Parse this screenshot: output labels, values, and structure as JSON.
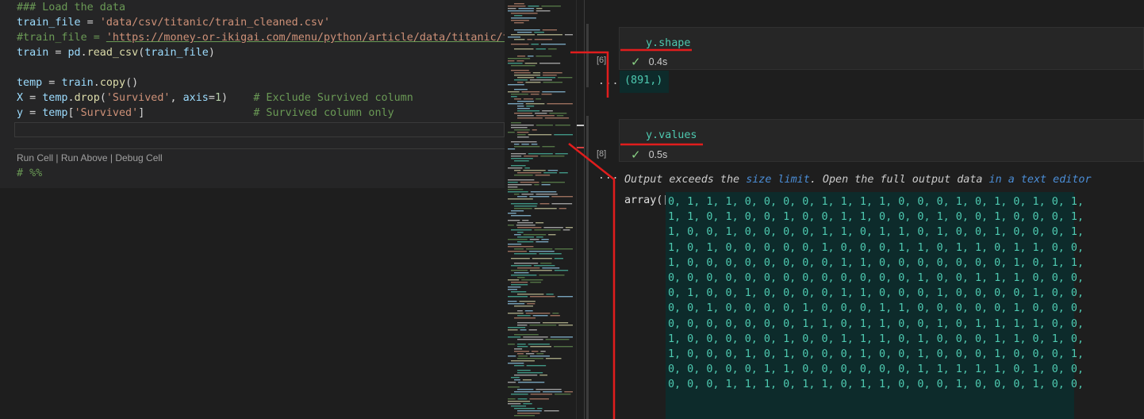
{
  "editor": {
    "lines": [
      {
        "parts": [
          {
            "t": "### Load the data",
            "c": "c-comment"
          }
        ]
      },
      {
        "parts": [
          {
            "t": "train_file",
            "c": "c-var"
          },
          {
            "t": " = ",
            "c": "c-op"
          },
          {
            "t": "'data/csv/titanic/train_cleaned.csv'",
            "c": "c-str"
          }
        ]
      },
      {
        "parts": [
          {
            "t": "#train_file = ",
            "c": "c-comment"
          },
          {
            "t": "'https://money-or-ikigai.com/menu/python/article/data/titanic/trai",
            "c": "c-link"
          }
        ]
      },
      {
        "parts": [
          {
            "t": "train",
            "c": "c-var"
          },
          {
            "t": " = ",
            "c": "c-op"
          },
          {
            "t": "pd",
            "c": "c-var"
          },
          {
            "t": ".",
            "c": "c-op"
          },
          {
            "t": "read_csv",
            "c": "c-fn"
          },
          {
            "t": "(",
            "c": "c-op"
          },
          {
            "t": "train_file",
            "c": "c-var"
          },
          {
            "t": ")",
            "c": "c-op"
          }
        ]
      },
      {
        "parts": []
      },
      {
        "parts": [
          {
            "t": "temp",
            "c": "c-var"
          },
          {
            "t": " = ",
            "c": "c-op"
          },
          {
            "t": "train",
            "c": "c-var"
          },
          {
            "t": ".",
            "c": "c-op"
          },
          {
            "t": "copy",
            "c": "c-fn"
          },
          {
            "t": "()",
            "c": "c-op"
          }
        ]
      },
      {
        "parts": [
          {
            "t": "X",
            "c": "c-var"
          },
          {
            "t": " = ",
            "c": "c-op"
          },
          {
            "t": "temp",
            "c": "c-var"
          },
          {
            "t": ".",
            "c": "c-op"
          },
          {
            "t": "drop",
            "c": "c-fn"
          },
          {
            "t": "(",
            "c": "c-op"
          },
          {
            "t": "'Survived'",
            "c": "c-str"
          },
          {
            "t": ", ",
            "c": "c-op"
          },
          {
            "t": "axis",
            "c": "c-var"
          },
          {
            "t": "=",
            "c": "c-op"
          },
          {
            "t": "1",
            "c": "c-num"
          },
          {
            "t": ")    ",
            "c": "c-op"
          },
          {
            "t": "# Exclude Survived column",
            "c": "c-comment"
          }
        ]
      },
      {
        "parts": [
          {
            "t": "y",
            "c": "c-var"
          },
          {
            "t": " = ",
            "c": "c-op"
          },
          {
            "t": "temp",
            "c": "c-var"
          },
          {
            "t": "[",
            "c": "c-op"
          },
          {
            "t": "'Survived'",
            "c": "c-str"
          },
          {
            "t": "]                 ",
            "c": "c-op"
          },
          {
            "t": "# Survived column only",
            "c": "c-comment"
          }
        ]
      }
    ],
    "codelens": [
      "Run Cell",
      "Run Above",
      "Debug Cell"
    ],
    "next_cell_marker": "# %%"
  },
  "notebook": {
    "cells": [
      {
        "source": "y.shape",
        "exec_count": "[6]",
        "duration": "0.4s",
        "more": "...",
        "output": "(891,)"
      },
      {
        "source": "y.values",
        "exec_count": "[8]",
        "duration": "0.5s",
        "more": "..."
      }
    ],
    "warning": {
      "pre": "Output exceeds the ",
      "link1": "size limit",
      "mid": ". Open the full output data ",
      "link2": "in a text editor"
    },
    "array_prefix": "array([",
    "array_rows": [
      "0, 1, 1, 1, 0, 0, 0, 0, 1, 1, 1, 1, 0, 0, 0, 1, 0, 1, 0, 1, 0, 1,",
      "1, 1, 0, 1, 0, 0, 1, 0, 0, 1, 1, 0, 0, 0, 1, 0, 0, 1, 0, 0, 0, 1,",
      "1, 0, 0, 1, 0, 0, 0, 0, 1, 1, 0, 1, 1, 0, 1, 0, 0, 1, 0, 0, 0, 1,",
      "1, 0, 1, 0, 0, 0, 0, 0, 1, 0, 0, 0, 1, 1, 0, 1, 1, 0, 1, 1, 0, 0,",
      "1, 0, 0, 0, 0, 0, 0, 0, 0, 1, 1, 0, 0, 0, 0, 0, 0, 0, 1, 0, 1, 1,",
      "0, 0, 0, 0, 0, 0, 0, 0, 0, 0, 0, 0, 0, 1, 0, 0, 1, 1, 1, 0, 0, 0,",
      "0, 1, 0, 0, 1, 0, 0, 0, 0, 1, 1, 0, 0, 0, 1, 0, 0, 0, 0, 1, 0, 0,",
      "0, 0, 1, 0, 0, 0, 0, 1, 0, 0, 0, 1, 1, 0, 0, 0, 0, 0, 1, 0, 0, 0,",
      "0, 0, 0, 0, 0, 0, 0, 1, 1, 0, 1, 1, 0, 0, 1, 0, 1, 1, 1, 1, 0, 0,",
      "1, 0, 0, 0, 0, 0, 1, 0, 0, 1, 1, 1, 0, 1, 0, 0, 0, 1, 1, 0, 1, 0,",
      "1, 0, 0, 0, 1, 0, 1, 0, 0, 0, 1, 0, 0, 1, 0, 0, 0, 1, 0, 0, 0, 1,",
      "0, 0, 0, 0, 0, 1, 1, 0, 0, 0, 0, 0, 0, 1, 1, 1, 1, 1, 0, 1, 0, 0,",
      "0, 0, 0, 1, 1, 1, 0, 1, 1, 0, 1, 1, 0, 0, 0, 1, 0, 0, 0, 1, 0, 0,"
    ]
  },
  "colors": {
    "annotation": "#e11d1d",
    "output_bg": "#0d2b2b",
    "accent": "#4ec9b0"
  }
}
